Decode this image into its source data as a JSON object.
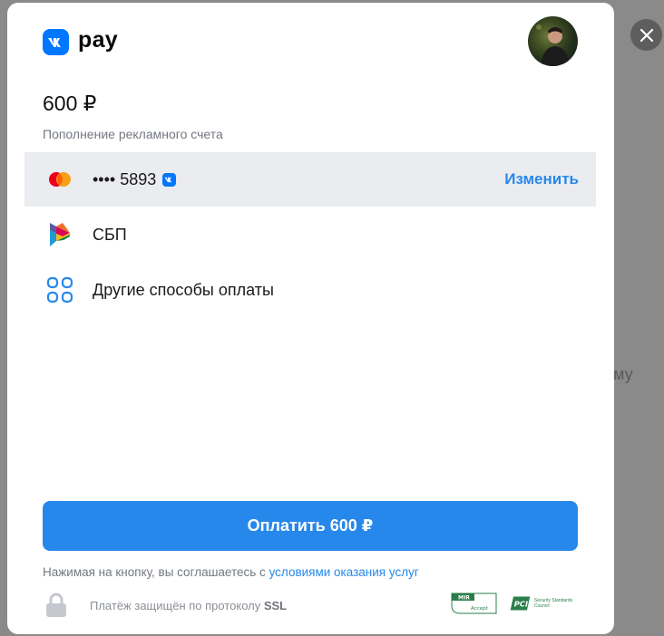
{
  "backdrop": {
    "peek_text": "му"
  },
  "close": {
    "icon": "close-icon"
  },
  "logo": {
    "word": "pay",
    "mark_icon": "vk-logo-icon",
    "brand_color": "#0077ff"
  },
  "avatar": {
    "icon": "user-avatar"
  },
  "payment": {
    "amount": "600 ₽",
    "purpose": "Пополнение рекламного счета"
  },
  "methods": [
    {
      "id": "card",
      "icon": "mastercard-icon",
      "label": "•••• 5893",
      "badge_icon": "vk-badge-icon",
      "action": "Изменить",
      "selected": true
    },
    {
      "id": "sbp",
      "icon": "sbp-icon",
      "label": "СБП",
      "selected": false
    },
    {
      "id": "other",
      "icon": "grid-icon",
      "label": "Другие способы оплаты",
      "selected": false
    }
  ],
  "pay_button": {
    "label": "Оплатить 600 ₽",
    "color": "#2688eb"
  },
  "terms": {
    "prefix": "Нажимая на кнопку, вы соглашаетесь с ",
    "link": "условиями оказания услуг"
  },
  "security": {
    "text": "Платёж защищён по протоколу ",
    "protocol": "SSL",
    "badges": [
      {
        "icon": "mir-accept-icon",
        "label": "MIR",
        "sublabel": "Accept"
      },
      {
        "icon": "pci-dss-icon",
        "label": "PCI",
        "sublabel": "Security Standards Council"
      }
    ]
  },
  "colors": {
    "accent": "#2688eb",
    "selected_row": "#ebecef",
    "muted_text": "#737880"
  }
}
